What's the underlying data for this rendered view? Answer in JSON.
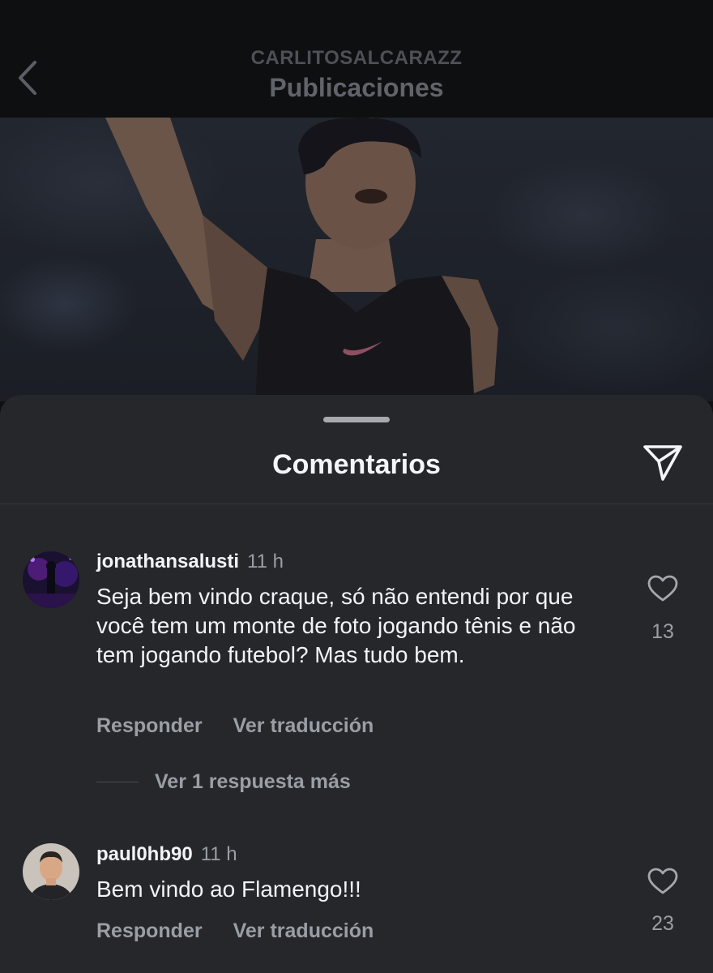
{
  "header": {
    "account": "CARLITOSALCARAZZ",
    "title": "Publicaciones"
  },
  "sheet": {
    "title": "Comentarios"
  },
  "comments": [
    {
      "username": "jonathansalusti",
      "time": "11 h",
      "text": "Seja bem vindo craque, só não entendi por que você tem um monte de foto jogando tênis e não tem jogando futebol? Mas tudo bem.",
      "likes": "13",
      "reply_label": "Responder",
      "translate_label": "Ver traducción",
      "more_replies": "Ver 1 respuesta más"
    },
    {
      "username": "paul0hb90",
      "time": "11 h",
      "text": "Bem vindo ao Flamengo!!!",
      "likes": "23",
      "reply_label": "Responder",
      "translate_label": "Ver traducción"
    }
  ],
  "colors": {
    "sheet_bg": "#25272b",
    "text_primary": "#f2f3f5",
    "text_secondary": "#9a9ea5"
  },
  "icons": [
    "back-chevron-icon",
    "send-icon",
    "heart-icon"
  ]
}
